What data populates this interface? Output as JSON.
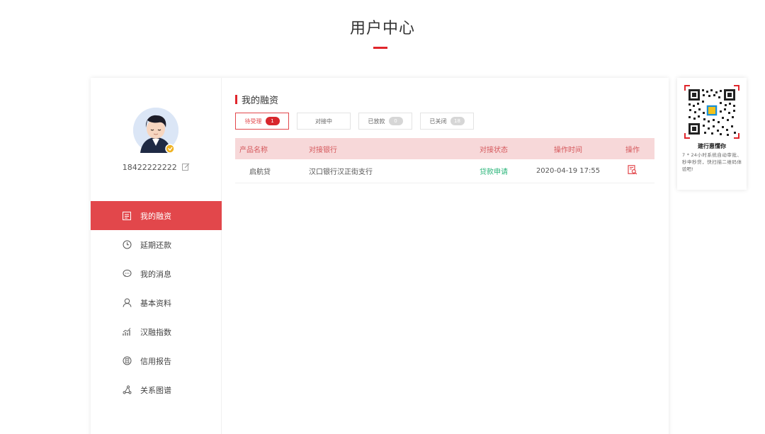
{
  "page": {
    "title": "用户中心"
  },
  "user": {
    "phone": "18422222222"
  },
  "menu": {
    "items": [
      {
        "label": "我的融资",
        "icon": "finance-list-icon",
        "active": true
      },
      {
        "label": "延期还款",
        "icon": "clock-icon"
      },
      {
        "label": "我的消息",
        "icon": "message-icon"
      },
      {
        "label": "基本资料",
        "icon": "user-icon"
      },
      {
        "label": "汉融指数",
        "icon": "chart-index-icon"
      },
      {
        "label": "信用报告",
        "icon": "credit-report-icon"
      },
      {
        "label": "关系图谱",
        "icon": "relation-graph-icon"
      }
    ]
  },
  "main": {
    "section_title": "我的融资",
    "tabs": [
      {
        "label": "待受理",
        "count": "1",
        "active": true
      },
      {
        "label": "对接中",
        "count": ""
      },
      {
        "label": "已放款",
        "count": "0"
      },
      {
        "label": "已关闭",
        "count": "18"
      }
    ],
    "table": {
      "headers": [
        "产品名称",
        "对接银行",
        "对接状态",
        "操作时间",
        "操作"
      ],
      "rows": [
        {
          "product": "启航贷",
          "bank": "汉口银行汉正街支行",
          "status": "贷款申请",
          "time": "2020-04-19 17:55"
        }
      ]
    }
  },
  "qr": {
    "title": "建行惠懂你",
    "desc": "7 * 24小时系统自动审批、秒申秒贷，快扫描二维码体验吧!"
  },
  "colors": {
    "accent": "#e2474b",
    "status_ok": "#2bb57a",
    "header_bg": "#f7d8d9"
  }
}
